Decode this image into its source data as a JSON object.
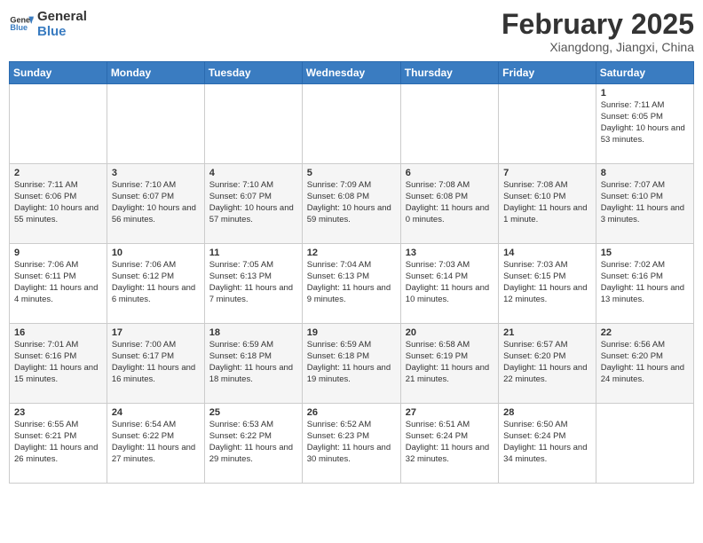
{
  "logo": {
    "line1": "General",
    "line2": "Blue"
  },
  "title": "February 2025",
  "location": "Xiangdong, Jiangxi, China",
  "weekdays": [
    "Sunday",
    "Monday",
    "Tuesday",
    "Wednesday",
    "Thursday",
    "Friday",
    "Saturday"
  ],
  "weeks": [
    [
      {
        "day": "",
        "info": ""
      },
      {
        "day": "",
        "info": ""
      },
      {
        "day": "",
        "info": ""
      },
      {
        "day": "",
        "info": ""
      },
      {
        "day": "",
        "info": ""
      },
      {
        "day": "",
        "info": ""
      },
      {
        "day": "1",
        "info": "Sunrise: 7:11 AM\nSunset: 6:05 PM\nDaylight: 10 hours and 53 minutes."
      }
    ],
    [
      {
        "day": "2",
        "info": "Sunrise: 7:11 AM\nSunset: 6:06 PM\nDaylight: 10 hours and 55 minutes."
      },
      {
        "day": "3",
        "info": "Sunrise: 7:10 AM\nSunset: 6:07 PM\nDaylight: 10 hours and 56 minutes."
      },
      {
        "day": "4",
        "info": "Sunrise: 7:10 AM\nSunset: 6:07 PM\nDaylight: 10 hours and 57 minutes."
      },
      {
        "day": "5",
        "info": "Sunrise: 7:09 AM\nSunset: 6:08 PM\nDaylight: 10 hours and 59 minutes."
      },
      {
        "day": "6",
        "info": "Sunrise: 7:08 AM\nSunset: 6:08 PM\nDaylight: 11 hours and 0 minutes."
      },
      {
        "day": "7",
        "info": "Sunrise: 7:08 AM\nSunset: 6:10 PM\nDaylight: 11 hours and 1 minute."
      },
      {
        "day": "8",
        "info": "Sunrise: 7:07 AM\nSunset: 6:10 PM\nDaylight: 11 hours and 3 minutes."
      }
    ],
    [
      {
        "day": "9",
        "info": "Sunrise: 7:06 AM\nSunset: 6:11 PM\nDaylight: 11 hours and 4 minutes."
      },
      {
        "day": "10",
        "info": "Sunrise: 7:06 AM\nSunset: 6:12 PM\nDaylight: 11 hours and 6 minutes."
      },
      {
        "day": "11",
        "info": "Sunrise: 7:05 AM\nSunset: 6:13 PM\nDaylight: 11 hours and 7 minutes."
      },
      {
        "day": "12",
        "info": "Sunrise: 7:04 AM\nSunset: 6:13 PM\nDaylight: 11 hours and 9 minutes."
      },
      {
        "day": "13",
        "info": "Sunrise: 7:03 AM\nSunset: 6:14 PM\nDaylight: 11 hours and 10 minutes."
      },
      {
        "day": "14",
        "info": "Sunrise: 7:03 AM\nSunset: 6:15 PM\nDaylight: 11 hours and 12 minutes."
      },
      {
        "day": "15",
        "info": "Sunrise: 7:02 AM\nSunset: 6:16 PM\nDaylight: 11 hours and 13 minutes."
      }
    ],
    [
      {
        "day": "16",
        "info": "Sunrise: 7:01 AM\nSunset: 6:16 PM\nDaylight: 11 hours and 15 minutes."
      },
      {
        "day": "17",
        "info": "Sunrise: 7:00 AM\nSunset: 6:17 PM\nDaylight: 11 hours and 16 minutes."
      },
      {
        "day": "18",
        "info": "Sunrise: 6:59 AM\nSunset: 6:18 PM\nDaylight: 11 hours and 18 minutes."
      },
      {
        "day": "19",
        "info": "Sunrise: 6:59 AM\nSunset: 6:18 PM\nDaylight: 11 hours and 19 minutes."
      },
      {
        "day": "20",
        "info": "Sunrise: 6:58 AM\nSunset: 6:19 PM\nDaylight: 11 hours and 21 minutes."
      },
      {
        "day": "21",
        "info": "Sunrise: 6:57 AM\nSunset: 6:20 PM\nDaylight: 11 hours and 22 minutes."
      },
      {
        "day": "22",
        "info": "Sunrise: 6:56 AM\nSunset: 6:20 PM\nDaylight: 11 hours and 24 minutes."
      }
    ],
    [
      {
        "day": "23",
        "info": "Sunrise: 6:55 AM\nSunset: 6:21 PM\nDaylight: 11 hours and 26 minutes."
      },
      {
        "day": "24",
        "info": "Sunrise: 6:54 AM\nSunset: 6:22 PM\nDaylight: 11 hours and 27 minutes."
      },
      {
        "day": "25",
        "info": "Sunrise: 6:53 AM\nSunset: 6:22 PM\nDaylight: 11 hours and 29 minutes."
      },
      {
        "day": "26",
        "info": "Sunrise: 6:52 AM\nSunset: 6:23 PM\nDaylight: 11 hours and 30 minutes."
      },
      {
        "day": "27",
        "info": "Sunrise: 6:51 AM\nSunset: 6:24 PM\nDaylight: 11 hours and 32 minutes."
      },
      {
        "day": "28",
        "info": "Sunrise: 6:50 AM\nSunset: 6:24 PM\nDaylight: 11 hours and 34 minutes."
      },
      {
        "day": "",
        "info": ""
      }
    ]
  ]
}
